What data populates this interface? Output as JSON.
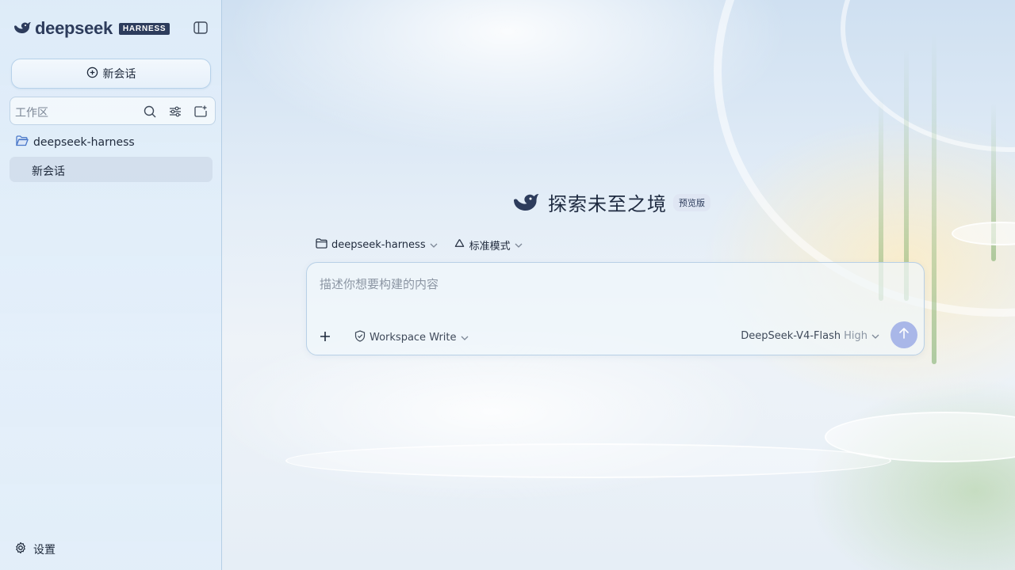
{
  "brand": {
    "name": "deepseek",
    "badge": "HARNESS"
  },
  "sidebar": {
    "new_chat_label": "新会话",
    "workspace_placeholder": "工作区",
    "project": {
      "name": "deepseek-harness"
    },
    "sessions": [
      {
        "label": "新会话",
        "active": true
      }
    ],
    "settings_label": "设置"
  },
  "main": {
    "title": "探索未至之境",
    "badge": "预览版",
    "context": {
      "folder": "deepseek-harness",
      "mode": "标准模式"
    },
    "composer": {
      "placeholder": "描述你想要构建的内容",
      "permission": "Workspace Write",
      "model": "DeepSeek-V4-Flash",
      "effort": "High"
    }
  },
  "colors": {
    "accent": "#2d3c5c",
    "send": "#a9b7e8",
    "folder": "#4a78c9"
  }
}
